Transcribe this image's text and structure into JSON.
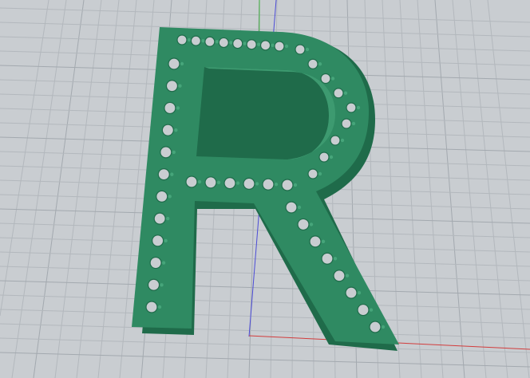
{
  "viewport": {
    "background_color": "#c9cdd1",
    "grid_color": "#b3b8bd",
    "grid_major_color": "#a3a9af",
    "model_color": "#2f8a62",
    "model_shadow_color": "#1f6b4a",
    "model_highlight_color": "#46a57a",
    "x_axis_color": "#d23c3c",
    "y_axis_color": "#3cae3c",
    "z_axis_color": "#4b4bd6"
  }
}
